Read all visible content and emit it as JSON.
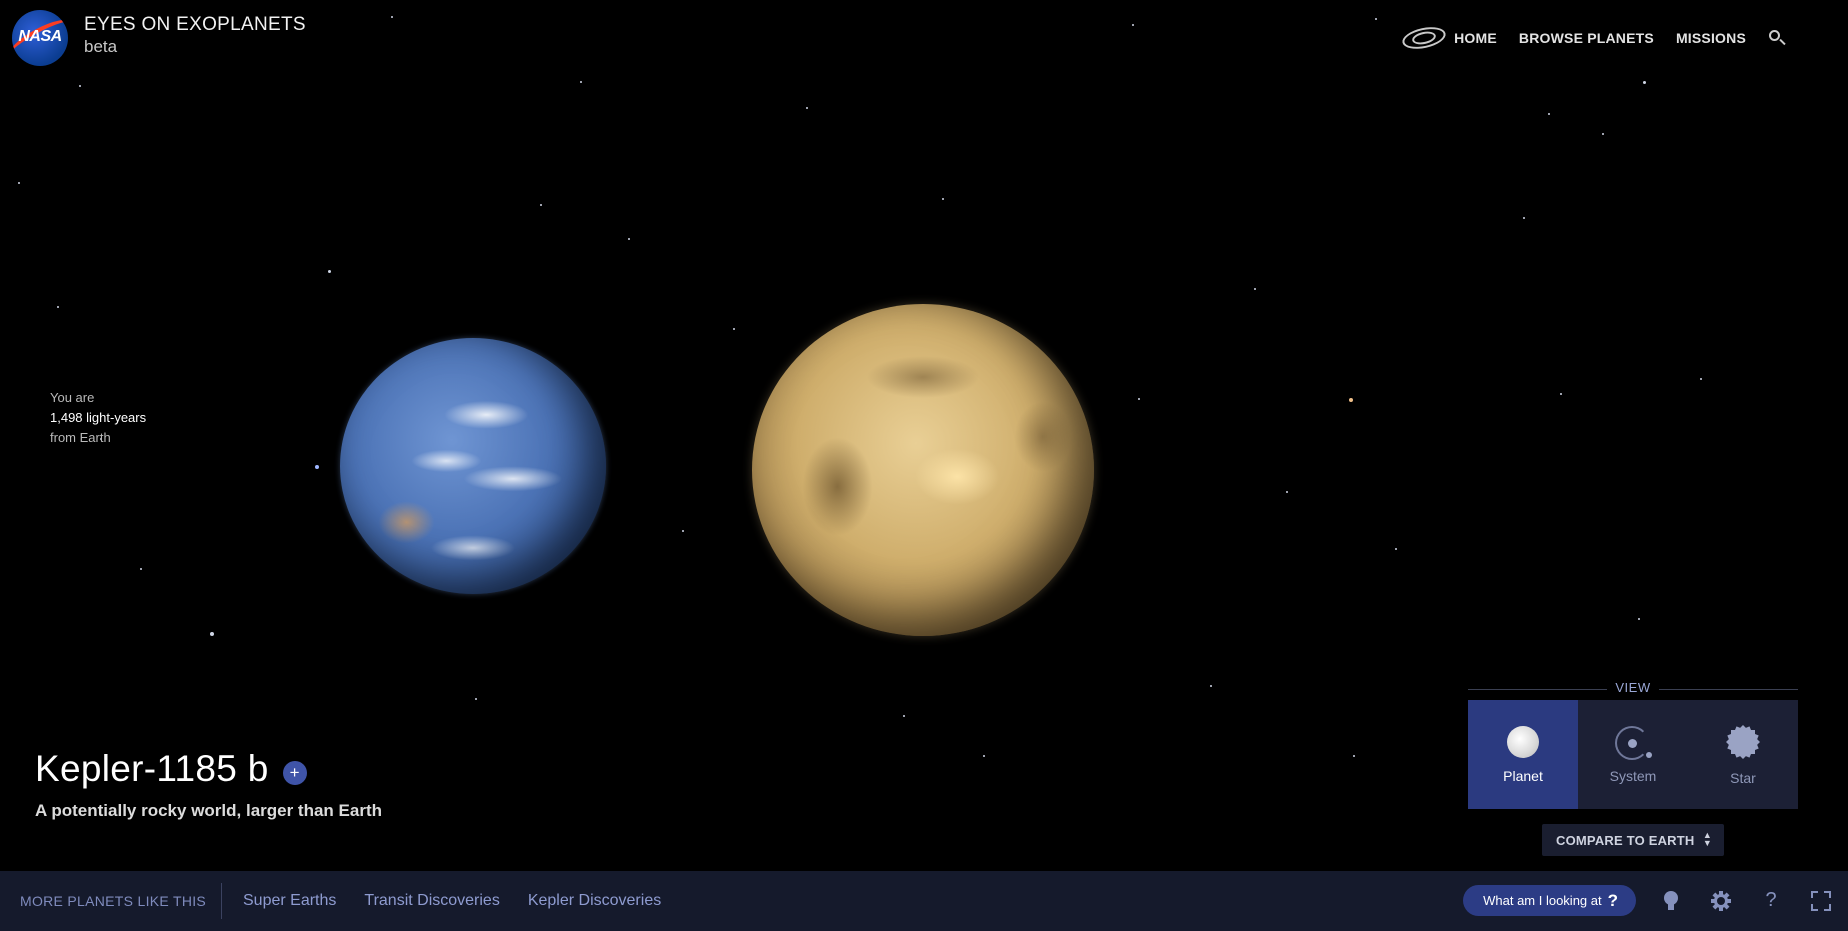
{
  "header": {
    "logo_text": "NASA",
    "title": "EYES ON EXOPLANETS",
    "subtitle": "beta"
  },
  "nav": {
    "items": [
      "HOME",
      "BROWSE PLANETS",
      "MISSIONS"
    ],
    "icons": [
      "galaxy-icon",
      "search-icon"
    ]
  },
  "distance": {
    "prefix": "You are",
    "value": "1,498 light-years",
    "suffix": "from Earth"
  },
  "planet": {
    "name": "Kepler-1185 b",
    "add_label": "+",
    "tagline": "A potentially rocky world, larger than Earth"
  },
  "view": {
    "label": "VIEW",
    "options": [
      "Planet",
      "System",
      "Star"
    ],
    "selected": "Planet",
    "compare_label": "COMPARE TO EARTH"
  },
  "bottom_bar": {
    "more_label": "MORE PLANETS LIKE THIS",
    "links": [
      "Super Earths",
      "Transit Discoveries",
      "Kepler Discoveries"
    ],
    "help_pill": "What am I looking at",
    "help_pill_q": "?",
    "question_icon": "?",
    "icons": [
      "lightbulb-icon",
      "gear-icon",
      "help-icon",
      "fullscreen-icon"
    ]
  },
  "colors": {
    "background": "#000000",
    "bar": "#151a2c",
    "accent": "#2b3a80",
    "link": "#8e9bd0"
  }
}
